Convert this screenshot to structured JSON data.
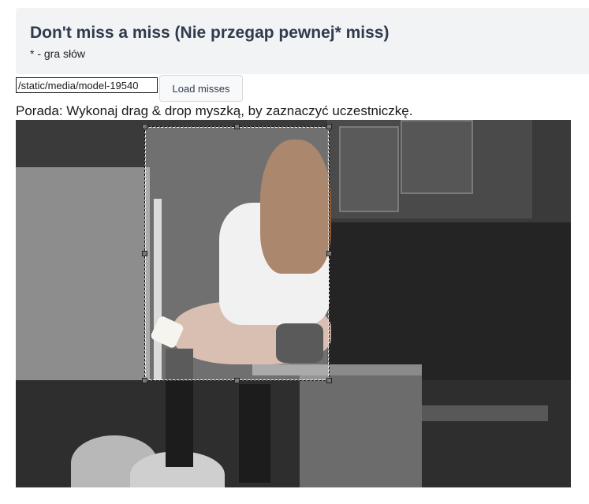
{
  "header": {
    "title": "Don't miss a miss (Nie przegap pewnej* miss)",
    "subtitle": "* - gra słów"
  },
  "toolbar": {
    "url_value": "/static/media/model-19540",
    "load_label": "Load misses"
  },
  "hint": "Porada: Wykonaj drag & drop myszką, by zaznaczyć uczestniczkę.",
  "colors": {
    "header_bg": "#f2f3f5",
    "title_color": "#2f3b4c",
    "button_bg": "#f8f9fa"
  }
}
